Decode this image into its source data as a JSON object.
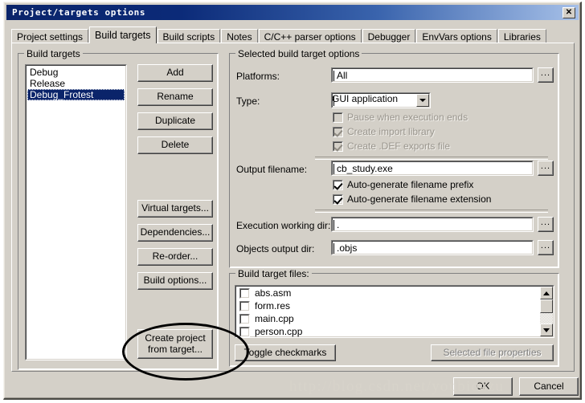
{
  "window": {
    "title": "Project/targets options",
    "close_label": "✕"
  },
  "tabs": [
    {
      "label": "Project settings",
      "active": false
    },
    {
      "label": "Build targets",
      "active": true
    },
    {
      "label": "Build scripts",
      "active": false
    },
    {
      "label": "Notes",
      "active": false
    },
    {
      "label": "C/C++ parser options",
      "active": false
    },
    {
      "label": "Debugger",
      "active": false
    },
    {
      "label": "EnvVars options",
      "active": false
    },
    {
      "label": "Libraries",
      "active": false
    }
  ],
  "build_targets": {
    "group_title": "Build targets",
    "items": [
      {
        "label": "Debug",
        "selected": false
      },
      {
        "label": "Release",
        "selected": false
      },
      {
        "label": "Debug_Frotest",
        "selected": true
      }
    ],
    "buttons": [
      {
        "label": "Add"
      },
      {
        "label": "Rename"
      },
      {
        "label": "Duplicate"
      },
      {
        "label": "Delete"
      },
      {
        "label": "Virtual targets..."
      },
      {
        "label": "Dependencies..."
      },
      {
        "label": "Re-order..."
      },
      {
        "label": "Build options..."
      }
    ],
    "create_project_button": "Create project\nfrom target..."
  },
  "options": {
    "group_title": "Selected build target options",
    "platforms_label": "Platforms:",
    "platforms_value": "All",
    "platforms_browse": "...",
    "type_label": "Type:",
    "type_value": "GUI application",
    "type_options": [
      "GUI application"
    ],
    "checkboxes_top": [
      {
        "label": "Pause when execution ends",
        "checked": false,
        "disabled": true
      },
      {
        "label": "Create import library",
        "checked": true,
        "disabled": true
      },
      {
        "label": "Create .DEF exports file",
        "checked": true,
        "disabled": true
      }
    ],
    "output_filename_label": "Output filename:",
    "output_filename_value": "cb_study.exe",
    "output_filename_browse": "...",
    "checkboxes_mid": [
      {
        "label": "Auto-generate filename prefix",
        "checked": true,
        "disabled": false
      },
      {
        "label": "Auto-generate filename extension",
        "checked": true,
        "disabled": false
      }
    ],
    "exec_dir_label": "Execution working dir:",
    "exec_dir_value": ".",
    "exec_dir_browse": "...",
    "objects_dir_label": "Objects output dir:",
    "objects_dir_value": ".objs",
    "objects_dir_browse": "..."
  },
  "target_files": {
    "group_title": "Build target files:",
    "files": [
      {
        "name": "abs.asm",
        "checked": false
      },
      {
        "name": "form.res",
        "checked": false
      },
      {
        "name": "main.cpp",
        "checked": false
      },
      {
        "name": "person.cpp",
        "checked": false
      }
    ],
    "toggle_button": "Toggle checkmarks",
    "properties_button": "Selected file properties"
  },
  "footer": {
    "ok_label": "OK",
    "cancel_label": "Cancel"
  },
  "annotation": {
    "watermark": "http://blog.csdn.net/youbidazu"
  }
}
